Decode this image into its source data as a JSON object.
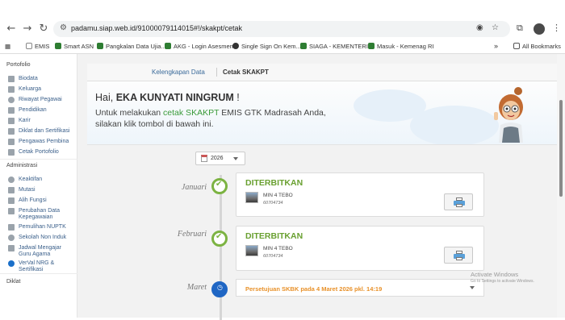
{
  "browser": {
    "url": "padamu.siap.web.id/91000079114015#!/skakpt/cetak",
    "bookmarks": [
      {
        "label": "EMIS",
        "color": "#7a7a7a"
      },
      {
        "label": "Smart ASN",
        "color": "#2e7d32"
      },
      {
        "label": "Pangkalan Data Ujia...",
        "color": "#2e7d32"
      },
      {
        "label": "AKG - Login Asesmen",
        "color": "#2e7d32"
      },
      {
        "label": "Single Sign On Kem...",
        "color": "#333333"
      },
      {
        "label": "SIAGA - KEMENTERI...",
        "color": "#2e7d32"
      },
      {
        "label": "Masuk - Kemenag RI",
        "color": "#2e7d32"
      }
    ],
    "more_bookmarks": "»",
    "all_bookmarks": "All Bookmarks"
  },
  "sidebar": {
    "sections": [
      {
        "title": "Portofolio",
        "items": [
          "Biodata",
          "Keluarga",
          "Riwayat Pegawai",
          "Pendidikan",
          "Karir",
          "Diklat dan Sertifikasi",
          "Pengawas Pembina",
          "Cetak Portofolio"
        ]
      },
      {
        "title": "Administrasi",
        "items": [
          "Keaktifan",
          "Mutasi",
          "Alih Fungsi",
          "Perubahan Data\nKepegawaian",
          "Pemulihan NUPTK",
          "Sekolah Non Induk",
          "Jadwal Mengajar\nGuru Agama",
          "VerVal NRG &\nSertifikasi"
        ]
      },
      {
        "title": "Diklat",
        "items": []
      }
    ]
  },
  "tabs": [
    {
      "label": "Kelengkapan Data",
      "active": false
    },
    {
      "label": "Cetak SKAKPT",
      "active": true
    }
  ],
  "hero": {
    "greeting_prefix": "Hai, ",
    "name": "EKA KUNYATI NINGRUM",
    "greeting_suffix": " !",
    "instr_a": "Untuk melakukan ",
    "instr_hl": "cetak SKAKPT",
    "instr_b": " EMIS GTK Madrasah Anda,",
    "instr_c": "silakan klik tombol di bawah ini."
  },
  "year_select": {
    "value": "2026"
  },
  "timeline": [
    {
      "month": "Januari",
      "status": "DITERBITKAN",
      "school": "MIN 4 TEBO",
      "npsn": "60704734"
    },
    {
      "month": "Februari",
      "status": "DITERBITKAN",
      "school": "MIN 4 TEBO",
      "npsn": "60704734"
    },
    {
      "month": "Maret",
      "pending": "Persetujuan SKBK pada 4 Maret 2026 pkl. 14:19"
    }
  ],
  "watermark": {
    "title": "Activate Windows",
    "subtitle": "Go to Settings to activate Windows."
  },
  "colors": {
    "accent_green": "#69a030",
    "pending_orange": "#e8912a",
    "link_blue": "#3a6a9a",
    "timeline_dot_blue": "#1f66c4"
  }
}
